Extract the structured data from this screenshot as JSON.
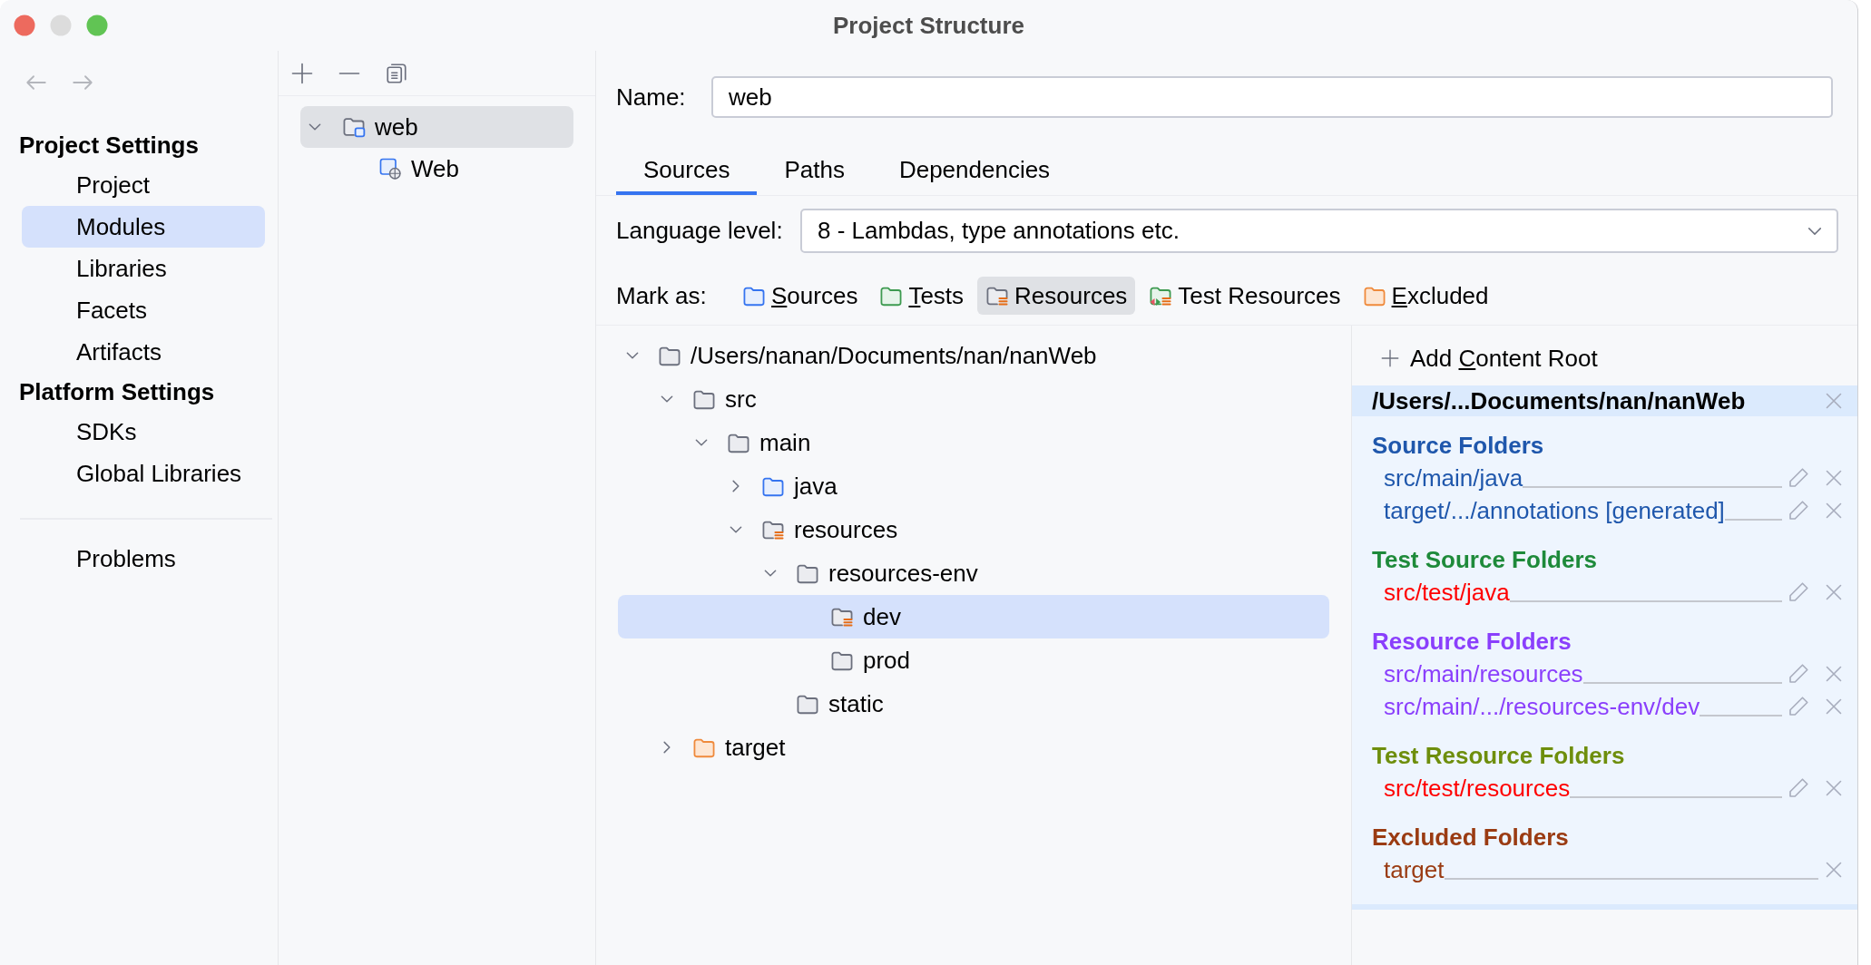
{
  "window": {
    "title": "Project Structure",
    "controls": [
      {
        "kind": "close",
        "disabled": false
      },
      {
        "kind": "minimize",
        "disabled": true
      },
      {
        "kind": "zoom",
        "disabled": false
      }
    ]
  },
  "nav": [
    {
      "kind": "back",
      "disabled": true
    },
    {
      "kind": "forward",
      "disabled": true
    }
  ],
  "sidebar": {
    "groups": [
      {
        "heading": "Project Settings",
        "items": [
          {
            "label": "Project",
            "selected": false
          },
          {
            "label": "Modules",
            "selected": true
          },
          {
            "label": "Libraries",
            "selected": false
          },
          {
            "label": "Facets",
            "selected": false
          },
          {
            "label": "Artifacts",
            "selected": false
          }
        ]
      },
      {
        "heading": "Platform Settings",
        "items": [
          {
            "label": "SDKs",
            "selected": false
          },
          {
            "label": "Global Libraries",
            "selected": false
          }
        ]
      }
    ],
    "footer_items": [
      {
        "label": "Problems",
        "selected": false
      }
    ]
  },
  "module_toolbar": [
    {
      "kind": "add"
    },
    {
      "kind": "remove"
    },
    {
      "kind": "copy"
    }
  ],
  "module_tree": [
    {
      "label": "web",
      "kind": "module",
      "expanded": true,
      "selected": true,
      "children": [
        {
          "label": "Web",
          "kind": "web",
          "selected": false
        }
      ]
    }
  ],
  "name_field": {
    "label": "Name:",
    "value": "web"
  },
  "tabs": [
    {
      "label": "Sources",
      "selected": true
    },
    {
      "label": "Paths",
      "selected": false
    },
    {
      "label": "Dependencies",
      "selected": false
    }
  ],
  "language_level": {
    "label": "Language level:",
    "value": "8 - Lambdas, type annotations etc."
  },
  "mark_as": {
    "label": "Mark as:",
    "buttons": [
      {
        "kind": "source",
        "label": "Sources",
        "mnemonic": true,
        "selected": false
      },
      {
        "kind": "test",
        "label": "Tests",
        "mnemonic": true,
        "selected": false
      },
      {
        "kind": "resource",
        "label": "Resources",
        "mnemonic": false,
        "selected": true
      },
      {
        "kind": "test_resource",
        "label": "Test Resources",
        "mnemonic": false,
        "selected": false
      },
      {
        "kind": "excluded",
        "label": "Excluded",
        "mnemonic": true,
        "selected": false
      }
    ]
  },
  "content_tree": [
    {
      "label": "/Users/nanan/Documents/nan/nanWeb",
      "kind": "plain",
      "expanded": true,
      "selected": false,
      "children": [
        {
          "label": "src",
          "kind": "plain",
          "expanded": true,
          "selected": false,
          "children": [
            {
              "label": "main",
              "kind": "plain",
              "expanded": true,
              "selected": false,
              "children": [
                {
                  "label": "java",
                  "kind": "source",
                  "expanded": false,
                  "selected": false
                },
                {
                  "label": "resources",
                  "kind": "resource",
                  "expanded": true,
                  "selected": false,
                  "children": [
                    {
                      "label": "resources-env",
                      "kind": "plain",
                      "expanded": true,
                      "selected": false,
                      "children": [
                        {
                          "label": "dev",
                          "kind": "resource",
                          "selected": true
                        },
                        {
                          "label": "prod",
                          "kind": "plain",
                          "selected": false
                        }
                      ]
                    },
                    {
                      "label": "static",
                      "kind": "plain",
                      "selected": false
                    }
                  ]
                }
              ]
            }
          ]
        },
        {
          "label": "target",
          "kind": "excluded",
          "expanded": false,
          "selected": false
        }
      ]
    }
  ],
  "content_root": {
    "add_button": {
      "lead": "Add",
      "label": "Content Root",
      "mnemonic": true
    },
    "path": "/Users/...Documents/nan/nanWeb",
    "sections": [
      {
        "kind": "source",
        "heading": "Source Folders",
        "items": [
          {
            "path": "src/main/java",
            "missing": false,
            "editable": true
          },
          {
            "path": "target/.../annotations [generated]",
            "missing": false,
            "editable": true
          }
        ]
      },
      {
        "kind": "test_source",
        "heading": "Test Source Folders",
        "items": [
          {
            "path": "src/test/java",
            "missing": true,
            "editable": true
          }
        ]
      },
      {
        "kind": "resource",
        "heading": "Resource Folders",
        "items": [
          {
            "path": "src/main/resources",
            "missing": false,
            "editable": true
          },
          {
            "path": "src/main/.../resources-env/dev",
            "missing": false,
            "editable": true
          }
        ]
      },
      {
        "kind": "test_resource",
        "heading": "Test Resource Folders",
        "items": [
          {
            "path": "src/test/resources",
            "missing": true,
            "editable": true
          }
        ]
      },
      {
        "kind": "excluded",
        "heading": "Excluded Folders",
        "items": [
          {
            "path": "target",
            "missing": false,
            "editable": false
          }
        ]
      }
    ]
  }
}
